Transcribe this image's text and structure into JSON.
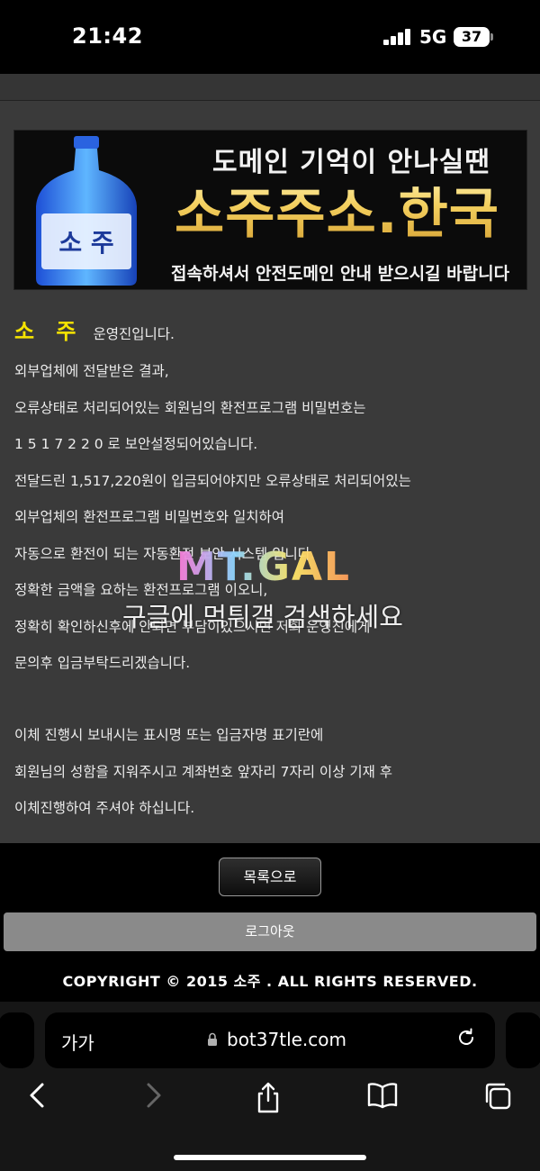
{
  "status_bar": {
    "time": "21:42",
    "network": "5G",
    "battery": "37"
  },
  "banner": {
    "line1": "도메인 기억이 안나실땐",
    "line2": "소주주소.한국",
    "line3": "접속하셔서 안전도메인 안내 받으시길 바랍니다",
    "bottle_label": "소 주"
  },
  "message": {
    "brand": "소 주",
    "brand_suffix": "운영진입니다.",
    "lines": [
      "외부업체에 전달받은 결과,",
      "오류상태로 처리되어있는 회원님의 환전프로그램 비밀번호는",
      "1 5 1 7 2 2 0 로 보안설정되어있습니다.",
      "전달드린 1,517,220원이 입금되어야지만 오류상태로 처리되어있는",
      "외부업체의 환전프로그램 비밀번호와 일치하여",
      "자동으로 환전이 되는 자동환전 보안 시스템 입니다.",
      "정확한 금액을 요하는 환전프로그램 이오니,",
      "정확히 확인하신후에 안되면 부담이있으시면 저희 운영진에게",
      "문의후 입금부탁드리겠습니다.",
      "이체 진행시 보내시는 표시명 또는 입금자명 표기란에",
      "회원님의 성함을 지워주시고 계좌번호 앞자리 7자리 이상 기재 후",
      "이체진행하여 주셔야 하십니다."
    ]
  },
  "watermark": {
    "logo": "MT.GAL",
    "text": "구글에 먹튀갤 검색하세요"
  },
  "buttons": {
    "list": "목록으로",
    "logout": "로그아웃"
  },
  "footer": {
    "copyright": "COPYRIGHT © 2015 소주 . ALL RIGHTS RESERVED."
  },
  "browser": {
    "text_size": "가가",
    "url": "bot37tle.com",
    "icons": {
      "lock": "lock-icon",
      "reload": "reload-icon",
      "back": "back-icon",
      "forward": "forward-icon",
      "share": "share-icon",
      "bookmarks": "bookmarks-icon",
      "tabs": "tabs-icon"
    }
  }
}
